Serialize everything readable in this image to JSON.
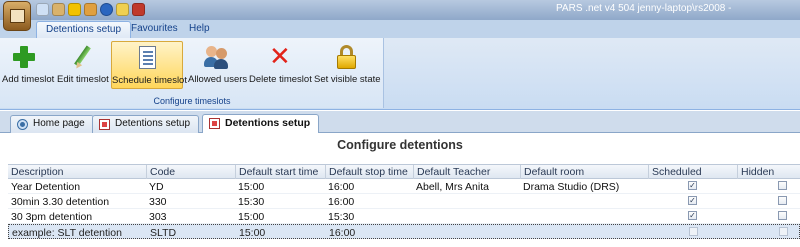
{
  "window": {
    "title_right": "PARS .net v4 504  jenny-laptop\\rs2008 -"
  },
  "ribbon_tabs": [
    {
      "label": "Detentions setup",
      "active": true
    },
    {
      "label": "Favourites",
      "active": false
    },
    {
      "label": "Help",
      "active": false
    }
  ],
  "ribbon": {
    "group_label": "Configure timeslots",
    "buttons": [
      {
        "label": "Add timeslot",
        "icon": "add-icon"
      },
      {
        "label": "Edit timeslot",
        "icon": "pencil-icon"
      },
      {
        "label": "Schedule timeslot",
        "icon": "schedule-icon",
        "selected": true
      },
      {
        "label": "Allowed users",
        "icon": "users-icon"
      },
      {
        "label": "Delete timeslot",
        "icon": "delete-icon"
      },
      {
        "label": "Set visible state",
        "icon": "lock-icon"
      }
    ]
  },
  "doc_tabs": [
    {
      "label": "Home page",
      "icon": "home-icon"
    },
    {
      "label": "Detentions setup",
      "icon": "document-icon"
    },
    {
      "label": "Detentions setup",
      "icon": "document-icon",
      "active": true
    }
  ],
  "panel": {
    "title": "Configure detentions"
  },
  "grid": {
    "columns": [
      "Description",
      "Code",
      "Default start time",
      "Default stop time",
      "Default Teacher",
      "Default room",
      "Scheduled",
      "Hidden"
    ],
    "rows": [
      {
        "description": "Year Detention",
        "code": "YD",
        "start": "15:00",
        "stop": "16:00",
        "teacher": "Abell, Mrs Anita",
        "room": "Drama Studio (DRS)",
        "scheduled": "✓",
        "hidden": ""
      },
      {
        "description": "30min 3.30 detention",
        "code": "330",
        "start": "15:30",
        "stop": "16:00",
        "teacher": "",
        "room": "",
        "scheduled": "✓",
        "hidden": ""
      },
      {
        "description": "30 3pm detention",
        "code": "303",
        "start": "15:00",
        "stop": "15:30",
        "teacher": "",
        "room": "",
        "scheduled": "✓",
        "hidden": ""
      },
      {
        "description": "example: SLT detention",
        "code": "SLTD",
        "start": "15:00",
        "stop": "16:00",
        "teacher": "",
        "room": "",
        "scheduled": "",
        "hidden": "",
        "selected": true
      }
    ]
  },
  "colors": {
    "ribbon_text": "#15428b",
    "selected_button": "#ffd65a",
    "selected_row": "#dbe6f4"
  }
}
